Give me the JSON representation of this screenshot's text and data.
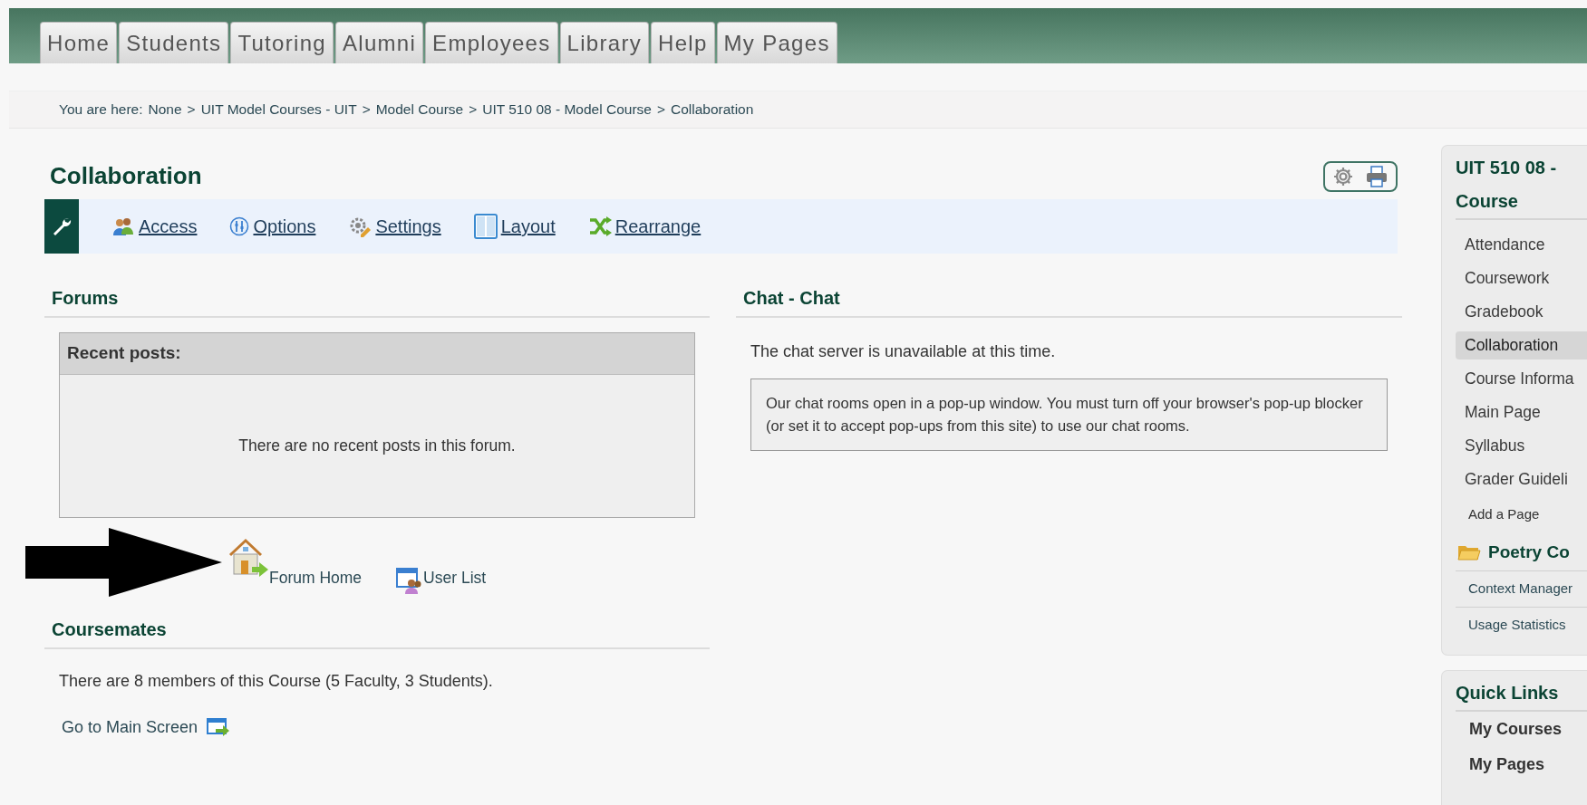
{
  "nav_tabs": [
    {
      "label": "Home"
    },
    {
      "label": "Students"
    },
    {
      "label": "Tutoring"
    },
    {
      "label": "Alumni"
    },
    {
      "label": "Employees"
    },
    {
      "label": "Library"
    },
    {
      "label": "Help"
    },
    {
      "label": "My Pages"
    }
  ],
  "breadcrumb": {
    "prefix": "You are here:",
    "separator": ">",
    "items": [
      "None",
      "UIT Model Courses - UIT",
      "Model Course",
      "UIT 510 08 - Model Course",
      "Collaboration"
    ]
  },
  "page_title": "Collaboration",
  "toolbar": [
    {
      "label": "Access"
    },
    {
      "label": "Options"
    },
    {
      "label": "Settings"
    },
    {
      "label": "Layout"
    },
    {
      "label": "Rearrange"
    }
  ],
  "forums": {
    "title": "Forums",
    "recent_posts": {
      "title": "Recent posts:",
      "message": "There are no recent posts in this forum."
    },
    "links": [
      {
        "label": "Forum Home"
      },
      {
        "label": "User List"
      }
    ]
  },
  "coursemates": {
    "title": "Coursemates",
    "summary": "There are 8 members of this Course (5 Faculty, 3 Students).",
    "link": "Go to Main Screen"
  },
  "chat": {
    "title": "Chat - Chat",
    "status": "The chat server is unavailable at this time.",
    "notice": "Our chat rooms open in a pop-up window. You must turn off your browser's pop-up blocker (or set it to accept pop-ups from this site) to use our chat rooms."
  },
  "sidebar": {
    "title": [
      "UIT 510 08 -",
      "Course"
    ],
    "items": [
      {
        "label": "Attendance",
        "kind": "page",
        "selected": false
      },
      {
        "label": "Coursework",
        "kind": "page",
        "selected": false
      },
      {
        "label": "Gradebook",
        "kind": "page",
        "selected": false
      },
      {
        "label": "Collaboration",
        "kind": "page",
        "selected": true
      },
      {
        "label": "Course Informa",
        "kind": "page",
        "selected": false
      },
      {
        "label": "Main Page",
        "kind": "page",
        "selected": false
      },
      {
        "label": "Syllabus",
        "kind": "page",
        "selected": false
      },
      {
        "label": "Grader Guideli",
        "kind": "page",
        "selected": false
      },
      {
        "label": "Add a Page",
        "kind": "action",
        "selected": false
      },
      {
        "label": "Poetry Co",
        "kind": "folder",
        "selected": false
      },
      {
        "label": "Context Manager",
        "kind": "tool",
        "selected": false
      },
      {
        "label": "Usage Statistics",
        "kind": "tool",
        "selected": false
      }
    ]
  },
  "quick_links": {
    "title": "Quick Links",
    "items": [
      "My Courses",
      "My Pages"
    ]
  }
}
